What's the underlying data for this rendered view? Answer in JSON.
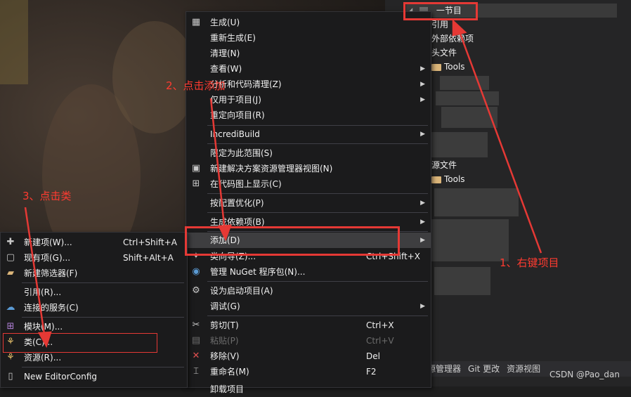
{
  "explorer": {
    "project_name": "一节目",
    "items": {
      "references": "引用",
      "external_deps": "外部依赖项",
      "header_files": "头文件",
      "tools_1": "Tools",
      "source_files": "源文件",
      "tools_2": "Tools"
    },
    "tabs": [
      "源管理器",
      "Git 更改",
      "资源视图"
    ]
  },
  "watermark": "CSDN @Pao_dan",
  "main_menu": [
    {
      "label": "生成(U)",
      "icon": "build-icon"
    },
    {
      "label": "重新生成(E)"
    },
    {
      "label": "清理(N)"
    },
    {
      "label": "查看(W)",
      "submenu": true
    },
    {
      "label": "分析和代码清理(Z)",
      "submenu": true
    },
    {
      "label": "仅用于项目(J)",
      "submenu": true
    },
    {
      "label": "重定向项目(R)"
    },
    {
      "label": "IncrediBuild",
      "submenu": true
    },
    {
      "label": "限定为此范围(S)"
    },
    {
      "label": "新建解决方案资源管理器视图(N)",
      "icon": "new-view-icon"
    },
    {
      "label": "在代码图上显示(C)",
      "icon": "code-map-icon"
    },
    {
      "label": "按配置优化(P)",
      "submenu": true
    },
    {
      "label": "生成依赖项(B)",
      "submenu": true
    },
    {
      "label": "添加(D)",
      "submenu": true
    },
    {
      "label": "类向导(Z)...",
      "shortcut": "Ctrl+Shift+X",
      "icon": "class-wizard-icon"
    },
    {
      "label": "管理 NuGet 程序包(N)...",
      "icon": "nuget-icon"
    },
    {
      "label": "设为启动项目(A)",
      "icon": "gear-icon"
    },
    {
      "label": "调试(G)",
      "submenu": true
    },
    {
      "label": "剪切(T)",
      "shortcut": "Ctrl+X",
      "icon": "cut-icon"
    },
    {
      "label": "粘贴(P)",
      "shortcut": "Ctrl+V",
      "icon": "paste-icon",
      "disabled": true
    },
    {
      "label": "移除(V)",
      "shortcut": "Del",
      "icon": "remove-icon"
    },
    {
      "label": "重命名(M)",
      "shortcut": "F2",
      "icon": "rename-icon"
    },
    {
      "label": "卸载项目"
    }
  ],
  "sub_menu": [
    {
      "label": "新建项(W)...",
      "shortcut": "Ctrl+Shift+A",
      "icon": "new-item-icon"
    },
    {
      "label": "现有项(G)...",
      "shortcut": "Shift+Alt+A",
      "icon": "existing-item-icon"
    },
    {
      "label": "新建筛选器(F)",
      "icon": "new-filter-icon"
    },
    {
      "label": "引用(R)..."
    },
    {
      "label": "连接的服务(C)",
      "icon": "connected-services-icon"
    },
    {
      "label": "模块(M)...",
      "icon": "module-icon"
    },
    {
      "label": "类(C)...",
      "icon": "class-icon"
    },
    {
      "label": "资源(R)...",
      "icon": "resource-icon"
    },
    {
      "label": "New EditorConfig",
      "icon": "editorconfig-icon"
    }
  ],
  "annotations": {
    "step1": "1、右键项目",
    "step2": "2、点击添加",
    "step3": "3、点击类"
  },
  "colors": {
    "annotation": "#e53935",
    "menu_bg": "#1b1b1c",
    "highlight": "#3e3e40"
  }
}
